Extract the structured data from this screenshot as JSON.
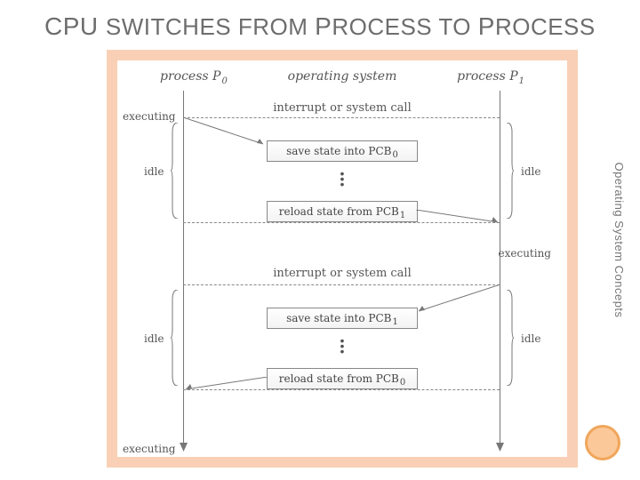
{
  "title_parts": {
    "cpu": "CPU ",
    "switches_from": "SWITCHES FROM",
    "process1": "PROCESS TO ",
    "process2": "P",
    "rocess": "ROCESS"
  },
  "title_plain": "CPU SWITCHES FROM PROCESS TO PROCESS",
  "side_label": "Operating System Concepts",
  "headers": {
    "left": "process P",
    "left_sub": "0",
    "center": "operating system",
    "right": "process P",
    "right_sub": "1"
  },
  "actions": {
    "int1": "interrupt or system call",
    "int2": "interrupt or system call"
  },
  "pcb": {
    "save0": "save state into PCB",
    "save0_sub": "0",
    "load1": "reload state from PCB",
    "load1_sub": "1",
    "save1": "save state into PCB",
    "save1_sub": "1",
    "load0": "reload state from PCB",
    "load0_sub": "0"
  },
  "states": {
    "exec": "executing",
    "idle": "idle"
  },
  "dots": "•",
  "colors": {
    "frame": "#f9d0b6",
    "bullet_fill": "#fbc899",
    "bullet_ring": "#f0a65a"
  }
}
